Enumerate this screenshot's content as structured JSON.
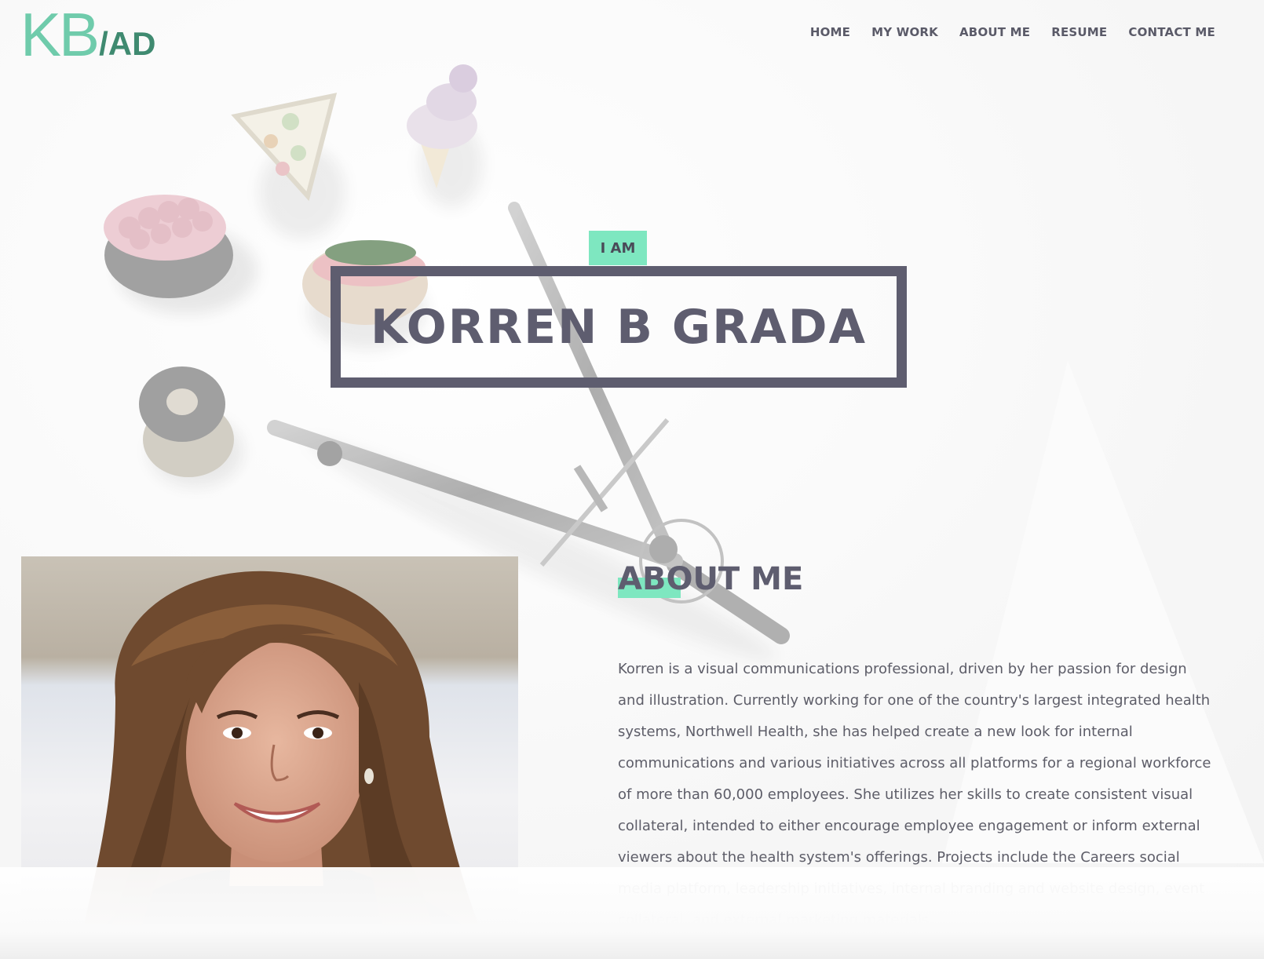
{
  "header": {
    "logo": {
      "primary": "KB",
      "secondary": "/AD"
    },
    "nav": [
      {
        "label": "HOME"
      },
      {
        "label": "MY WORK"
      },
      {
        "label": "ABOUT ME"
      },
      {
        "label": "RESUME"
      },
      {
        "label": "CONTACT ME"
      }
    ]
  },
  "hero": {
    "badge": "I AM",
    "name": "KORREN B GRADA",
    "illustration": "erasers-and-compass"
  },
  "about": {
    "heading": "ABOUT ME",
    "photo": "portrait-photo",
    "body": "Korren is a visual communications professional, driven by her passion for design and illustration. Currently working for one of the country's largest integrated health systems, Northwell Health, she has helped create a new look for internal communications and various initiatives across all platforms for a regional workforce of more than 60,000 employees. She utilizes her skills to create consistent visual collateral, intended to either encourage employee engagement or inform external viewers about the health system's offerings. Projects include the Careers social media platform, leadership initiatives, internal branding and website design, event collateral, and external marketing materials."
  },
  "colors": {
    "accent": "#7ee7c0",
    "logo_light": "#6fcbab",
    "logo_dark": "#3f8a70",
    "text_dark": "#5e5d6f",
    "body_text": "#5d5d68"
  }
}
